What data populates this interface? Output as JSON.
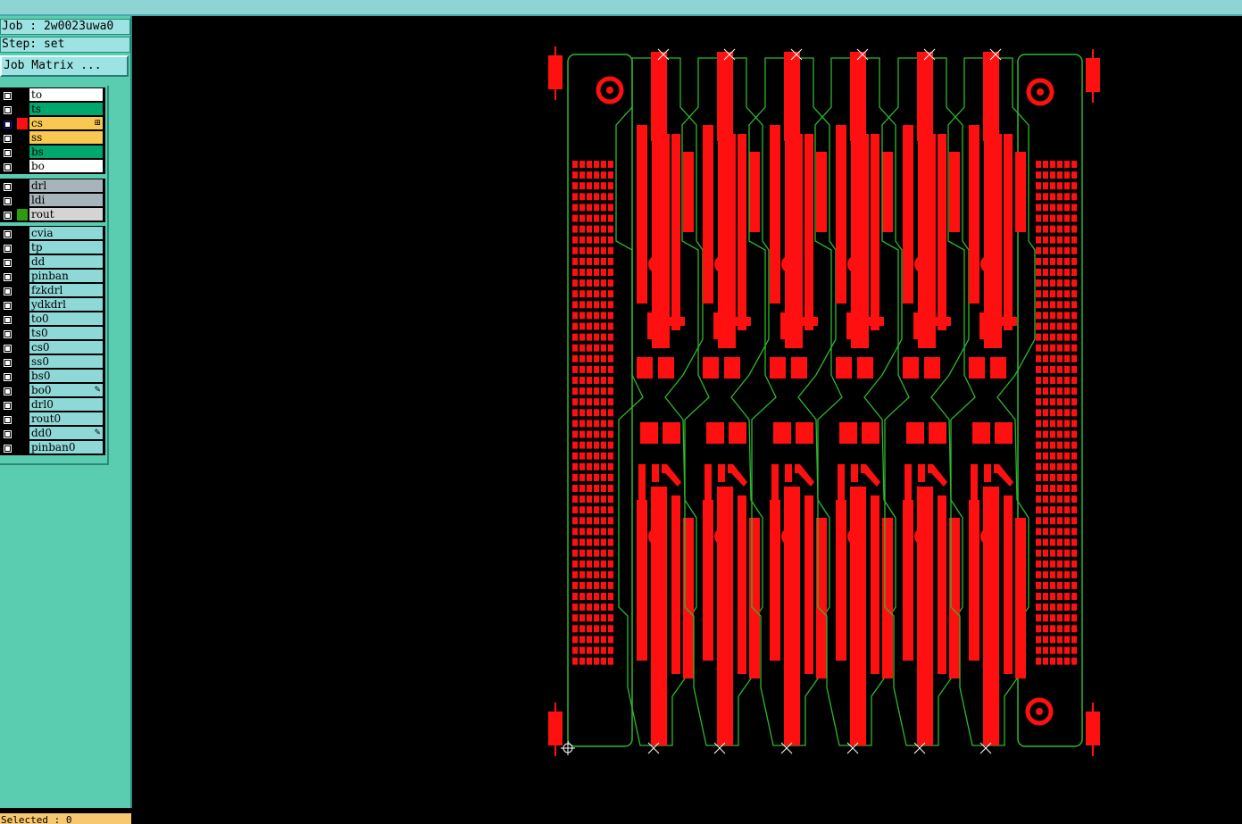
{
  "job": "Job : 2w0023uwa0",
  "step": "Step: set",
  "job_matrix_label": "Job Matrix ...",
  "status": "Selected : 0",
  "colors": {
    "copper": "#ff1010",
    "outline": "#2db82d",
    "background": "#000000"
  },
  "layer_groups": [
    {
      "layers": [
        {
          "name": "to",
          "bg": "#ffffff",
          "swatch": "#000000"
        },
        {
          "name": "ts",
          "bg": "#00a870",
          "swatch": "#000000"
        },
        {
          "name": "cs",
          "bg": "#f8c850",
          "swatch": "#ff1010",
          "active": true,
          "tag": "⊞"
        },
        {
          "name": "ss",
          "bg": "#f8c850",
          "swatch": "#000000"
        },
        {
          "name": "bs",
          "bg": "#00a870",
          "swatch": "#000000"
        },
        {
          "name": "bo",
          "bg": "#ffffff",
          "swatch": "#000000"
        }
      ]
    },
    {
      "layers": [
        {
          "name": "drl",
          "bg": "#a8b4bc",
          "swatch": "#000000"
        },
        {
          "name": "ldi",
          "bg": "#a8b4bc",
          "swatch": "#000000"
        },
        {
          "name": "rout",
          "bg": "#d4d4d4",
          "swatch": "#2e9a10"
        }
      ]
    },
    {
      "layers": [
        {
          "name": "cvia",
          "bg": "#8fd8d8",
          "swatch": "#000000"
        },
        {
          "name": "tp",
          "bg": "#8fd8d8",
          "swatch": "#000000"
        },
        {
          "name": "dd",
          "bg": "#8fd8d8",
          "swatch": "#000000"
        },
        {
          "name": "pinban",
          "bg": "#8fd8d8",
          "swatch": "#000000"
        },
        {
          "name": "fzkdrl",
          "bg": "#8fd8d8",
          "swatch": "#000000"
        },
        {
          "name": "ydkdrl",
          "bg": "#8fd8d8",
          "swatch": "#000000"
        },
        {
          "name": "to0",
          "bg": "#8fd8d8",
          "swatch": "#000000"
        },
        {
          "name": "ts0",
          "bg": "#8fd8d8",
          "swatch": "#000000"
        },
        {
          "name": "cs0",
          "bg": "#8fd8d8",
          "swatch": "#000000"
        },
        {
          "name": "ss0",
          "bg": "#8fd8d8",
          "swatch": "#000000"
        },
        {
          "name": "bs0",
          "bg": "#8fd8d8",
          "swatch": "#000000"
        },
        {
          "name": "bo0",
          "bg": "#8fd8d8",
          "swatch": "#000000",
          "tag": "✎"
        },
        {
          "name": "drl0",
          "bg": "#8fd8d8",
          "swatch": "#000000"
        },
        {
          "name": "rout0",
          "bg": "#8fd8d8",
          "swatch": "#000000"
        },
        {
          "name": "dd0",
          "bg": "#8fd8d8",
          "swatch": "#000000",
          "tag": "✎"
        },
        {
          "name": "pinban0",
          "bg": "#8fd8d8",
          "swatch": "#000000"
        }
      ]
    }
  ]
}
